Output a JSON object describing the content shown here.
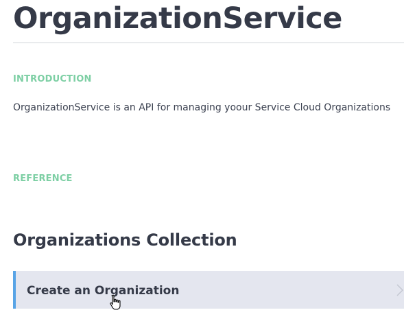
{
  "page": {
    "title": "OrganizationService"
  },
  "introduction": {
    "label": "INTRODUCTION",
    "text": "OrganizationService is an API for managing yoour Service Cloud Organizations"
  },
  "reference": {
    "label": "REFERENCE"
  },
  "collection": {
    "title": "Organizations Collection",
    "endpoints": [
      {
        "label": "Create an Organization",
        "icon": "chevron-right-icon"
      }
    ]
  },
  "colors": {
    "heading": "#353a48",
    "section_label": "#7dcfa4",
    "endpoint_bg": "#e4e6ef",
    "endpoint_accent": "#58a4e6"
  }
}
